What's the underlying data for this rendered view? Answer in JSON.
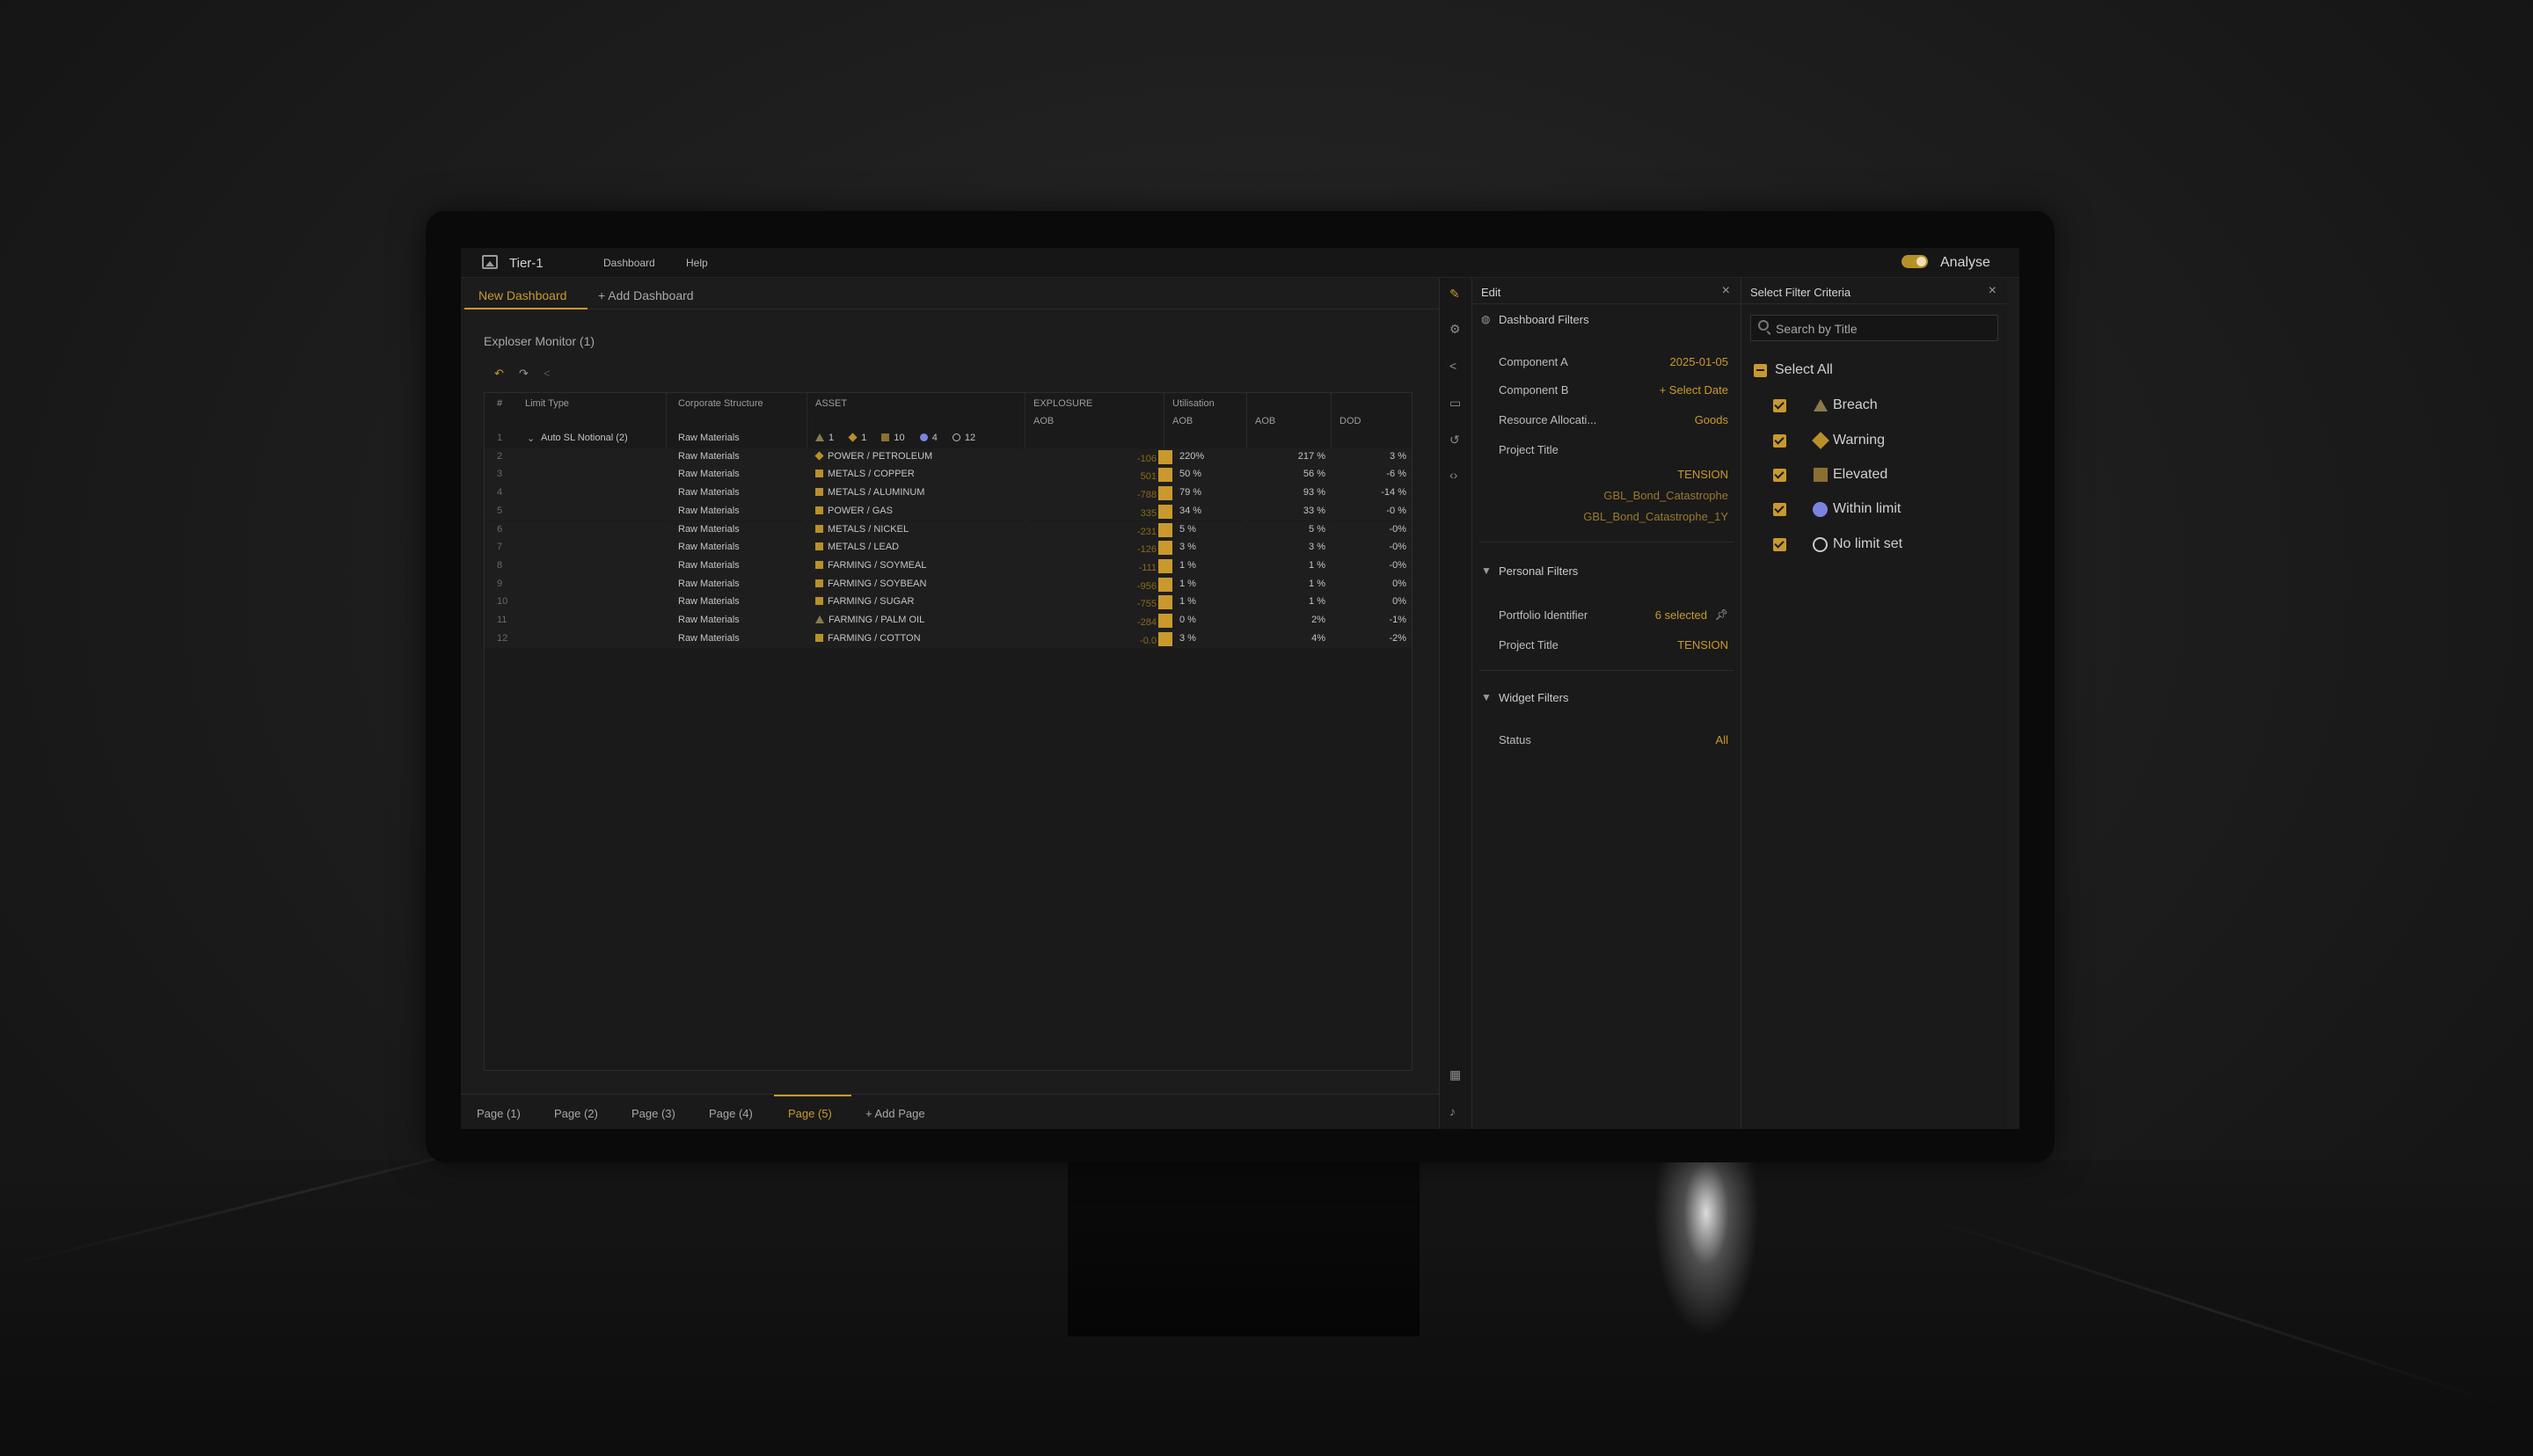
{
  "app": {
    "title": "Tier-1",
    "menu": [
      "Dashboard",
      "Help"
    ],
    "mode_label": "Analyse",
    "mode_on": true
  },
  "dashboard_tabs": {
    "active": "New Dashboard",
    "add": "+ Add Dashboard"
  },
  "widget": {
    "title": "Exploser Monitor (1)",
    "columns": {
      "num": "#",
      "limit_type": "Limit Type",
      "corporate": "Corporate Structure",
      "asset": "ASSET",
      "exposure": "EXPLOSURE",
      "exposure_sub": "AOB",
      "utilisation": "Utilisation",
      "util_sub": "AOB",
      "aob": "AOB",
      "dod": "DOD"
    },
    "summary_row": {
      "num": "1",
      "limit_type": "Auto SL Notional (2)",
      "corporate": "Raw Materials",
      "counts": [
        "1",
        "1",
        "10",
        "4",
        "12"
      ]
    },
    "rows": [
      {
        "num": "2",
        "corporate": "Raw Materials",
        "asset": "POWER / PETROLEUM",
        "marker": "diamond",
        "exposure": "-106",
        "util": "220%",
        "aob": "217 %",
        "dod": "3 %"
      },
      {
        "num": "3",
        "corporate": "Raw Materials",
        "asset": "METALS / COPPER",
        "marker": "square",
        "exposure": "501",
        "util": "50 %",
        "aob": "56 %",
        "dod": "-6 %"
      },
      {
        "num": "4",
        "corporate": "Raw Materials",
        "asset": "METALS / ALUMINUM",
        "marker": "square",
        "exposure": "-788",
        "util": "79 %",
        "aob": "93 %",
        "dod": "-14 %"
      },
      {
        "num": "5",
        "corporate": "Raw Materials",
        "asset": "POWER / GAS",
        "marker": "square",
        "exposure": "335",
        "util": "34 %",
        "aob": "33 %",
        "dod": "-0 %"
      },
      {
        "num": "6",
        "corporate": "Raw Materials",
        "asset": "METALS / NICKEL",
        "marker": "square",
        "exposure": "-231",
        "util": "5 %",
        "aob": "5 %",
        "dod": "-0%"
      },
      {
        "num": "7",
        "corporate": "Raw Materials",
        "asset": "METALS / LEAD",
        "marker": "square",
        "exposure": "-126",
        "util": "3 %",
        "aob": "3 %",
        "dod": "-0%"
      },
      {
        "num": "8",
        "corporate": "Raw Materials",
        "asset": "FARMING / SOYMEAL",
        "marker": "square",
        "exposure": "-111",
        "util": "1 %",
        "aob": "1 %",
        "dod": "-0%"
      },
      {
        "num": "9",
        "corporate": "Raw Materials",
        "asset": "FARMING / SOYBEAN",
        "marker": "square",
        "exposure": "-956",
        "util": "1 %",
        "aob": "1 %",
        "dod": "0%"
      },
      {
        "num": "10",
        "corporate": "Raw Materials",
        "asset": "FARMING / SUGAR",
        "marker": "square",
        "exposure": "-755",
        "util": "1 %",
        "aob": "1 %",
        "dod": "0%"
      },
      {
        "num": "11",
        "corporate": "Raw Materials",
        "asset": "FARMING / PALM OIL",
        "marker": "triangle",
        "exposure": "-284",
        "util": "0 %",
        "aob": "2%",
        "dod": "-1%"
      },
      {
        "num": "12",
        "corporate": "Raw Materials",
        "asset": "FARMING / COTTON",
        "marker": "square",
        "exposure": "-0.0",
        "util": "3 %",
        "aob": "4%",
        "dod": "-2%"
      }
    ]
  },
  "pages": {
    "items": [
      "Page (1)",
      "Page (2)",
      "Page (3)",
      "Page (4)",
      "Page (5)"
    ],
    "active": "Page (5)",
    "add": "+ Add Page"
  },
  "edit_panel": {
    "title": "Edit",
    "dashboard_filters": {
      "title": "Dashboard Filters",
      "component_a": {
        "label": "Component A",
        "value": "2025-01-05"
      },
      "component_b": {
        "label": "Component B",
        "value": "+ Select Date"
      },
      "resource": {
        "label": "Resource Allocati...",
        "value": "Goods"
      },
      "project": {
        "label": "Project Title",
        "values": [
          "TENSION",
          "GBL_Bond_Catastrophe",
          "GBL_Bond_Catastrophe_1Y"
        ]
      }
    },
    "personal_filters": {
      "title": "Personal Filters",
      "portfolio": {
        "label": "Portfolio Identifier",
        "value": "6 selected"
      },
      "project": {
        "label": "Project Title",
        "value": "TENSION"
      }
    },
    "widget_filters": {
      "title": "Widget Filters",
      "status": {
        "label": "Status",
        "value": "All"
      }
    }
  },
  "filter_panel": {
    "title": "Select Filter Criteria",
    "search_placeholder": "Search by Title",
    "select_all": "Select All",
    "options": [
      "Breach",
      "Warning",
      "Elevated",
      "Within limit",
      "No limit set"
    ]
  },
  "colors": {
    "accent": "#c9992e",
    "within_limit": "#7a84e0"
  }
}
